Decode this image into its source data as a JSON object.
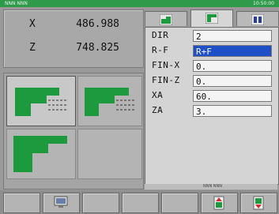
{
  "topbar": {
    "left_text": "NNN NNN",
    "right_text": "10:50:00"
  },
  "position": [
    {
      "axis": "X",
      "value": "486.988"
    },
    {
      "axis": "Z",
      "value": "748.825"
    }
  ],
  "params": [
    {
      "label": "DIR",
      "value": "2",
      "selected": false
    },
    {
      "label": "R-F",
      "value": "R+F",
      "selected": true
    },
    {
      "label": "FIN-X",
      "value": "0.",
      "selected": false
    },
    {
      "label": "FIN-Z",
      "value": "0.",
      "selected": false
    },
    {
      "label": "XA",
      "value": "60.",
      "selected": false
    },
    {
      "label": "ZA",
      "value": "3.",
      "selected": false
    }
  ],
  "status_strip": "NNN NNN",
  "colors": {
    "pattern_green": "#1e9a3e",
    "topbar": "#2e9a4a",
    "selection": "#1f4fc6"
  },
  "icons": {
    "tab_1": "turning-cycle-icon",
    "tab_2": "facing-cycle-icon",
    "tab_3": "tool-data-icon",
    "softkey_2": "monitor-icon",
    "softkey_6": "insert-icon",
    "softkey_7": "delete-icon"
  }
}
